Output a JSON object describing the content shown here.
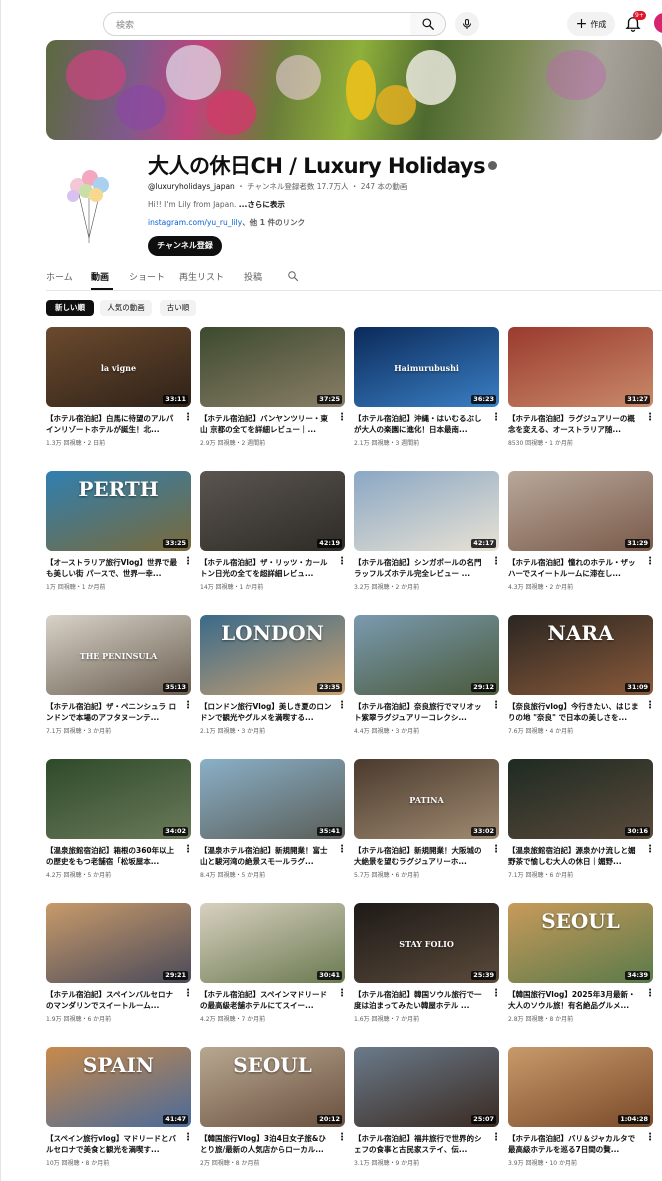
{
  "topbar": {
    "search_placeholder": "検索",
    "create_label": "作成",
    "notification_count": "9+"
  },
  "channel": {
    "title": "大人の休日CH / Luxury Holidays",
    "handle": "@luxuryholidays_japan",
    "stats": " ・ チャンネル登録者数 17.7万人 ・ 247 本の動画",
    "description": "Hi!! I'm Lily from Japan. ",
    "more_label": "...さらに表示",
    "link_text": "instagram.com/yu_ru_lily",
    "other_links": "、他 1 件のリンク",
    "subscribe_label": "チャンネル登録"
  },
  "tabs": [
    {
      "label": "ホーム"
    },
    {
      "label": "動画"
    },
    {
      "label": "ショート"
    },
    {
      "label": "再生リスト"
    },
    {
      "label": "投稿"
    }
  ],
  "chips": [
    {
      "label": "新しい順"
    },
    {
      "label": "人気の動画"
    },
    {
      "label": "古い順"
    }
  ],
  "colors": {
    "accent_red": "#e0142b",
    "link_blue": "#065fd4"
  },
  "videos": [
    {
      "title": "【ホテル宿泊記】白馬に待望のアルパインリゾートホテルが誕生！北...",
      "meta": "1.3万 回視聴・2 日前",
      "duration": "33:11",
      "overlay": "la vigne",
      "c1": "#6b4a2e",
      "c2": "#2f2218"
    },
    {
      "title": "【ホテル宿泊記】バンヤンツリー・東山 京都の全てを詳細レビュー｜...",
      "meta": "2.9万 回視聴・2 週間前",
      "duration": "37:25",
      "overlay": "",
      "c1": "#3c4a2e",
      "c2": "#8a7e68"
    },
    {
      "title": "【ホテル宿泊記】沖縄・はいむるぶしが大人の楽園に進化！日本最南...",
      "meta": "2.1万 回視聴・3 週間前",
      "duration": "36:23",
      "overlay": "Haimurubushi",
      "c1": "#0b2a5a",
      "c2": "#3a7fc4"
    },
    {
      "title": "【ホテル宿泊記】ラグジュアリーの概念を変える、オーストラリア随...",
      "meta": "8530 回視聴・1 か月前",
      "duration": "31:27",
      "overlay": "",
      "c1": "#9a3a2e",
      "c2": "#c98a6a"
    },
    {
      "title": "【オーストラリア旅行Vlog】世界で最も美しい街 パースで、世界一幸...",
      "meta": "1万 回視聴・1 か月前",
      "duration": "33:25",
      "overlay": "PERTH",
      "c1": "#2f7fb0",
      "c2": "#7a6a3a"
    },
    {
      "title": "【ホテル宿泊記】ザ・リッツ・カールトン日光の全てを超詳細レビュ...",
      "meta": "14万 回視聴・1 か月前",
      "duration": "42:19",
      "overlay": "",
      "c1": "#5a5550",
      "c2": "#2e2a26"
    },
    {
      "title": "【ホテル宿泊記】シンガポールの名門ラッフルズホテル完全レビュー ...",
      "meta": "3.2万 回視聴・2 か月前",
      "duration": "42:17",
      "overlay": "",
      "c1": "#8aa7c4",
      "c2": "#e8e2d4"
    },
    {
      "title": "【ホテル宿泊記】憧れのホテル・ザッハーでスイートルームに滞在し...",
      "meta": "4.3万 回視聴・2 か月前",
      "duration": "31:29",
      "overlay": "",
      "c1": "#b8a89a",
      "c2": "#7a5a4a"
    },
    {
      "title": "【ホテル宿泊記】ザ・ペニンシュラ ロンドンで本場のアフタヌーンテ...",
      "meta": "7.1万 回視聴・3 か月前",
      "duration": "35:13",
      "overlay": "THE PENINSULA",
      "c1": "#d8d2c8",
      "c2": "#6a5e50"
    },
    {
      "title": "【ロンドン旅行Vlog】美しき夏のロンドンで観光やグルメを満喫する...",
      "meta": "2.1万 回視聴・3 か月前",
      "duration": "23:35",
      "overlay": "LONDON",
      "c1": "#3a6a8a",
      "c2": "#c8a070"
    },
    {
      "title": "【ホテル宿泊記】奈良旅行でマリオット紫翠ラグジュアリーコレクシ...",
      "meta": "4.4万 回視聴・3 か月前",
      "duration": "29:12",
      "overlay": "",
      "c1": "#7a9ab0",
      "c2": "#4a5a3a"
    },
    {
      "title": "【奈良旅行vlog】今行きたい、はじまりの地 \"奈良\" で日本の美しさを...",
      "meta": "7.6万 回視聴・4 か月前",
      "duration": "31:09",
      "overlay": "NARA",
      "c1": "#2a2622",
      "c2": "#8a5a3a"
    },
    {
      "title": "【温泉旅館宿泊記】箱根の360年以上の歴史をもつ老舗宿「松坂屋本...",
      "meta": "4.2万 回視聴・5 か月前",
      "duration": "34:02",
      "overlay": "",
      "c1": "#2e4a2a",
      "c2": "#6a7a5a"
    },
    {
      "title": "【温泉ホテル宿泊記】新規開業！富士山と駿河湾の絶景スモールラグ...",
      "meta": "8.4万 回視聴・5 か月前",
      "duration": "35:41",
      "overlay": "",
      "c1": "#8ab0c8",
      "c2": "#5a5e58"
    },
    {
      "title": "【ホテル宿泊記】新規開業！大阪城の大絶景を望むラグジュアリーホ...",
      "meta": "5.7万 回視聴・6 か月前",
      "duration": "33:02",
      "overlay": "PATINA",
      "c1": "#4a3a2e",
      "c2": "#a08a70"
    },
    {
      "title": "【温泉旅館宿泊記】源泉かけ流しと媚野茶で愉しむ大人の休日｜媚野...",
      "meta": "7.1万 回視聴・6 か月前",
      "duration": "30:16",
      "overlay": "",
      "c1": "#1e2a22",
      "c2": "#5a4a3a"
    },
    {
      "title": "【ホテル宿泊記】スペインバルセロナのマンダリンでスイートルーム...",
      "meta": "1.9万 回視聴・6 か月前",
      "duration": "29:21",
      "overlay": "",
      "c1": "#c89a6a",
      "c2": "#4a4a5a"
    },
    {
      "title": "【ホテル宿泊記】スペインマドリードの最高級老舗ホテルにてスイー...",
      "meta": "4.2万 回視聴・7 か月前",
      "duration": "30:41",
      "overlay": "",
      "c1": "#d8d0c0",
      "c2": "#6a7a50"
    },
    {
      "title": "【ホテル宿泊記】韓国ソウル旅行で一度は泊まってみたい韓屋ホテル ...",
      "meta": "1.6万 回視聴・7 か月前",
      "duration": "25:39",
      "overlay": "STAY FOLIO",
      "c1": "#1e1a18",
      "c2": "#5a4a3a"
    },
    {
      "title": "【韓国旅行Vlog】2025年3月最新・大人のソウル旅！有名絶品グルメ...",
      "meta": "2.8万 回視聴・8 か月前",
      "duration": "34:39",
      "overlay": "SEOUL",
      "c1": "#c89a5a",
      "c2": "#5a7a4a"
    },
    {
      "title": "【スペイン旅行vlog】マドリードとバルセロナで美食と観光を満喫す...",
      "meta": "10万 回視聴・8 か月前",
      "duration": "41:47",
      "overlay": "SPAIN",
      "c1": "#c88a4a",
      "c2": "#4a6a9a"
    },
    {
      "title": "【韓国旅行Vlog】3泊4日女子旅&ひとり旅/最新の人気店からローカル...",
      "meta": "2万 回視聴・8 か月前",
      "duration": "20:12",
      "overlay": "SEOUL",
      "c1": "#b8a890",
      "c2": "#6a5040"
    },
    {
      "title": "【ホテル宿泊記】福井旅行で世界的シェフの食事と古民家ステイ、伝...",
      "meta": "3.1万 回視聴・9 か月前",
      "duration": "25:07",
      "overlay": "",
      "c1": "#6a7a8a",
      "c2": "#3a2a22"
    },
    {
      "title": "【ホテル宿泊記】バリ＆ジャカルタで最高級ホテルを巡る7日間の贅...",
      "meta": "3.9万 回視聴・10 か月前",
      "duration": "1:04:28",
      "overlay": "",
      "c1": "#c89a6a",
      "c2": "#7a4a2a"
    }
  ]
}
